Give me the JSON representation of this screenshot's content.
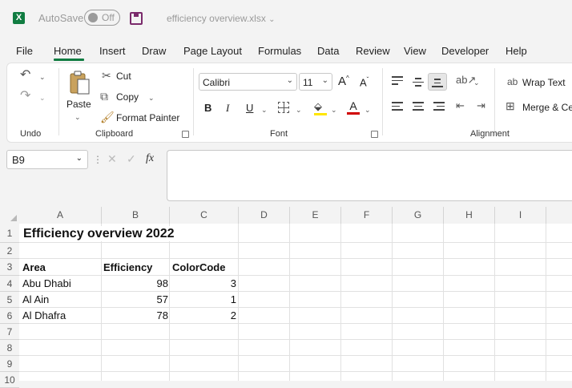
{
  "titlebar": {
    "logo_letter": "X",
    "autosave_label": "AutoSave",
    "autosave_state": "Off",
    "filename": "efficiency overview.xlsx",
    "filename_chevron": "⌄"
  },
  "menu": [
    "File",
    "Home",
    "Insert",
    "Draw",
    "Page Layout",
    "Formulas",
    "Data",
    "Review",
    "View",
    "Developer",
    "Help"
  ],
  "active_menu": "Home",
  "ribbon": {
    "undo_group": "Undo",
    "clipboard": {
      "paste": "Paste",
      "cut": "Cut",
      "copy": "Copy",
      "format_painter": "Format Painter",
      "group": "Clipboard"
    },
    "font": {
      "family": "Calibri",
      "size": "11",
      "bold": "B",
      "italic": "I",
      "underline": "U",
      "grow": "A",
      "shrink": "A",
      "group": "Font"
    },
    "alignment": {
      "wrap_text": "Wrap Text",
      "merge": "Merge & Ce",
      "group": "Alignment"
    }
  },
  "formula_bar": {
    "name_box": "B9",
    "fx": "fx",
    "formula": ""
  },
  "grid": {
    "columns": [
      "A",
      "B",
      "C",
      "D",
      "E",
      "F",
      "G",
      "H",
      "I"
    ],
    "rows": [
      "1",
      "2",
      "3",
      "4",
      "5",
      "6",
      "7",
      "8",
      "9",
      "10"
    ],
    "cells": {
      "A1": "Efficiency overview 2022",
      "A3": "Area",
      "B3": "Efficiency",
      "C3": "ColorCode",
      "A4": "Abu Dhabi",
      "B4": "98",
      "C4": "3",
      "A5": "Al Ain",
      "B5": "57",
      "C5": "1",
      "A6": "Al Dhafra",
      "B6": "78",
      "C6": "2"
    }
  },
  "colors": {
    "excel_green": "#107c41",
    "font_color_red": "#d00000",
    "highlight_yellow": "#ffe600",
    "save_purple": "#7a2a6b"
  }
}
